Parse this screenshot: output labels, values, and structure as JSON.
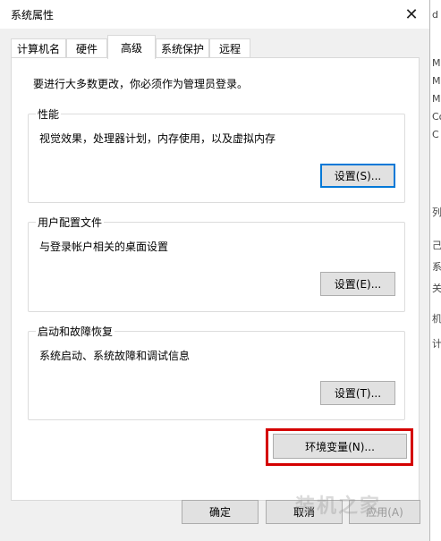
{
  "window": {
    "title": "系统属性",
    "close_glyph": "✕"
  },
  "tabs": [
    {
      "label": "计算机名",
      "active": false
    },
    {
      "label": "硬件",
      "active": false
    },
    {
      "label": "高级",
      "active": true
    },
    {
      "label": "系统保护",
      "active": false
    },
    {
      "label": "远程",
      "active": false
    }
  ],
  "advanced": {
    "admin_note": "要进行大多数更改，你必须作为管理员登录。",
    "performance": {
      "legend": "性能",
      "desc": "视觉效果，处理器计划，内存使用，以及虚拟内存",
      "button": "设置(S)..."
    },
    "profiles": {
      "legend": "用户配置文件",
      "desc": "与登录帐户相关的桌面设置",
      "button": "设置(E)..."
    },
    "startup": {
      "legend": "启动和故障恢复",
      "desc": "系统启动、系统故障和调试信息",
      "button": "设置(T)..."
    },
    "env_button": "环境变量(N)..."
  },
  "footer": {
    "ok": "确定",
    "cancel": "取消",
    "apply": "应用(A)"
  },
  "right_strip": [
    "d",
    "M",
    "M",
    "M",
    "Co",
    "C",
    "列",
    "己",
    "系",
    "关",
    "机",
    "计"
  ],
  "watermark": "装机之家",
  "colors": {
    "highlight_border": "#d40000",
    "focus_border": "#0078d7",
    "dialog_bg": "#f0f0f0"
  }
}
